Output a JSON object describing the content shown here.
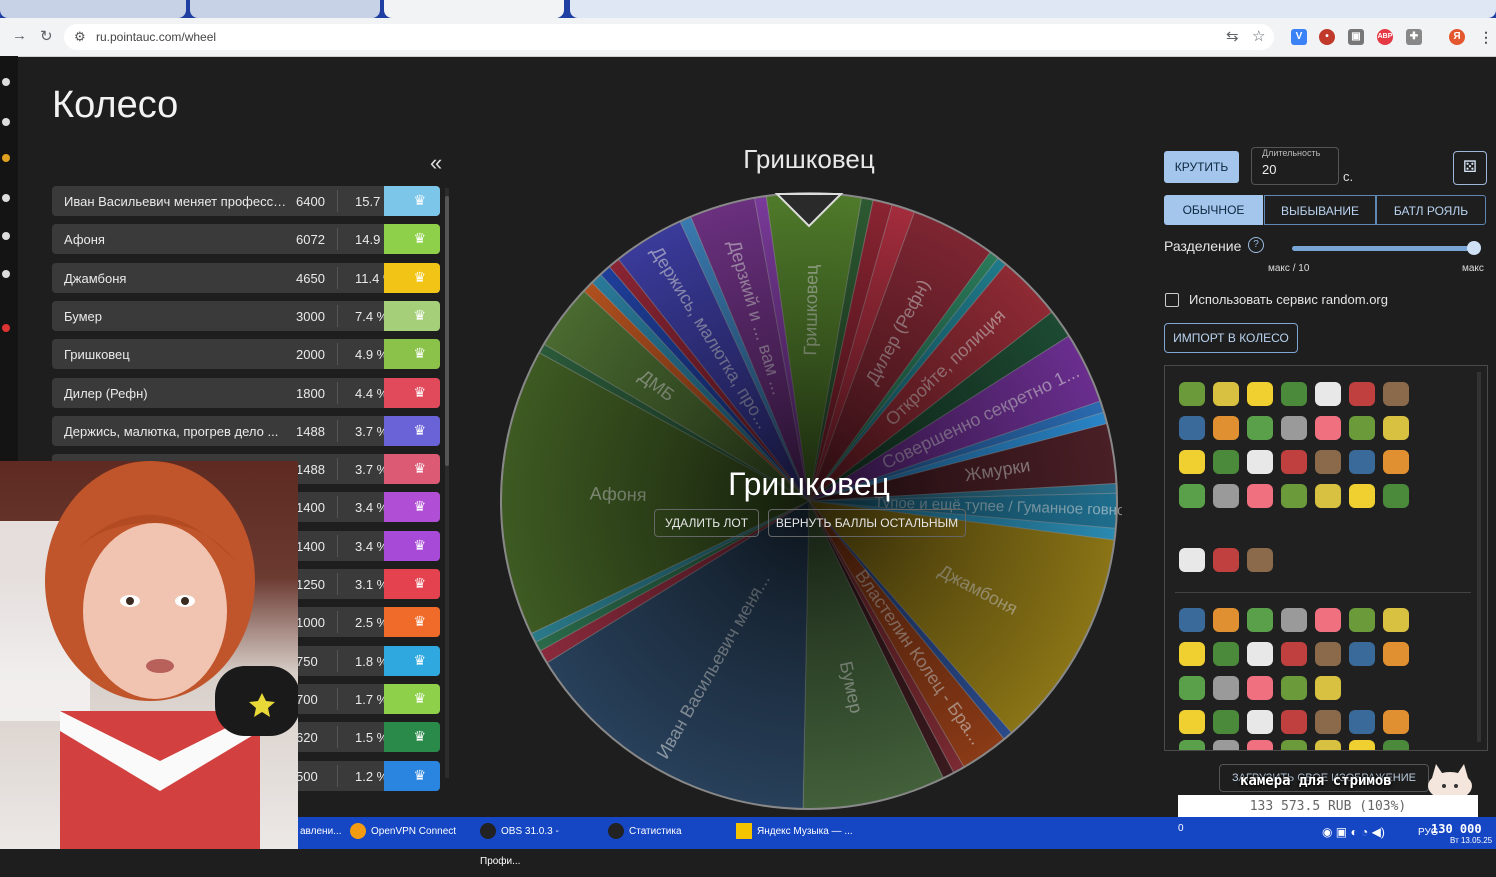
{
  "browser": {
    "url": "ru.pointauc.com/wheel"
  },
  "page": {
    "title": "Колесо",
    "collapse_icon": "«"
  },
  "lots": [
    {
      "name": "Иван Васильевич меняет профессию",
      "amount": "6400",
      "percent": "15.7 %",
      "color": "#7cc6ea"
    },
    {
      "name": "Афоня",
      "amount": "6072",
      "percent": "14.9 %",
      "color": "#8fd04b"
    },
    {
      "name": "Джамбоня",
      "amount": "4650",
      "percent": "11.4 %",
      "color": "#f2c416"
    },
    {
      "name": "Бумер",
      "amount": "3000",
      "percent": "7.4 %",
      "color": "#a6cf7a"
    },
    {
      "name": "Гришковец",
      "amount": "2000",
      "percent": "4.9 %",
      "color": "#8ac24a"
    },
    {
      "name": "Дилер (Рефн)",
      "amount": "1800",
      "percent": "4.4 %",
      "color": "#e14a5a"
    },
    {
      "name": "Держись, малютка, прогрев дело ...",
      "amount": "1488",
      "percent": "3.7 %",
      "color": "#6a63d8"
    },
    {
      "name": "",
      "amount": "1488",
      "percent": "3.7 %",
      "color": "#dd5a75"
    },
    {
      "name": "",
      "amount": "1400",
      "percent": "3.4 %",
      "color": "#b04fd6"
    },
    {
      "name": "",
      "amount": "1400",
      "percent": "3.4 %",
      "color": "#a84ad8"
    },
    {
      "name": "",
      "amount": "1250",
      "percent": "3.1 %",
      "color": "#e3424e"
    },
    {
      "name": "",
      "amount": "1000",
      "percent": "2.5 %",
      "color": "#f06a2a"
    },
    {
      "name": "",
      "amount": "750",
      "percent": "1.8 %",
      "color": "#2fa8e0"
    },
    {
      "name": "",
      "amount": "700",
      "percent": "1.7 %",
      "color": "#8fd04b"
    },
    {
      "name": "",
      "amount": "620",
      "percent": "1.5 %",
      "color": "#2a8a4a"
    },
    {
      "name": "",
      "amount": "500",
      "percent": "1.2 %",
      "color": "#2a85e0"
    }
  ],
  "wheel": {
    "winner_title": "Гришковец",
    "center_winner": "Гришковец",
    "delete_lot_label": "УДАЛИТЬ ЛОТ",
    "return_points_label": "ВЕРНУТЬ БАЛЛЫ ОСТАЛЬНЫМ",
    "segments": [
      {
        "label": "Гришковец",
        "value": 4.9,
        "color": "#4f7a2a"
      },
      {
        "label": "",
        "value": 0.6,
        "color": "#2d5a32"
      },
      {
        "label": "",
        "value": 1.0,
        "color": "#8a2432"
      },
      {
        "label": "",
        "value": 1.2,
        "color": "#a32c3c"
      },
      {
        "label": "Дилер (Рефн)",
        "value": 4.4,
        "color": "#7e2632"
      },
      {
        "label": "",
        "value": 0.5,
        "color": "#2a7a5a"
      },
      {
        "label": "",
        "value": 0.5,
        "color": "#1f7a8a"
      },
      {
        "label": "Откройте, полиция",
        "value": 3.4,
        "color": "#8e2a34"
      },
      {
        "label": "",
        "value": 1.5,
        "color": "#1d4a32"
      },
      {
        "label": "Совершенно секретно 1...",
        "value": 3.7,
        "color": "#6a2e8e"
      },
      {
        "label": "",
        "value": 0.6,
        "color": "#2a6ab0"
      },
      {
        "label": "",
        "value": 0.6,
        "color": "#2a85c8"
      },
      {
        "label": "Жмурки",
        "value": 3.1,
        "color": "#4a1f26"
      },
      {
        "label": "",
        "value": 0.5,
        "color": "#2b6e8a"
      },
      {
        "label": "Тупое и ещё тупее / Гуманное говно",
        "value": 1.8,
        "color": "#1f6e8e"
      },
      {
        "label": "",
        "value": 0.6,
        "color": "#2a8ab0"
      },
      {
        "label": "Джамбоня",
        "value": 11.4,
        "color": "#8a7416"
      },
      {
        "label": "",
        "value": 0.5,
        "color": "#2a4a8a"
      },
      {
        "label": "Властелин Колец - Бра...",
        "value": 2.5,
        "color": "#8a3a16"
      },
      {
        "label": "",
        "value": 0.6,
        "color": "#7a2a32"
      },
      {
        "label": "",
        "value": 0.6,
        "color": "#3a1a1e"
      },
      {
        "label": "Бумер",
        "value": 7.4,
        "color": "#42603a"
      },
      {
        "label": "Иван Васильевич меня...",
        "value": 15.7,
        "color": "#28405a"
      },
      {
        "label": "",
        "value": 0.7,
        "color": "#8a2a3c"
      },
      {
        "label": "",
        "value": 0.5,
        "color": "#2a6a4a"
      },
      {
        "label": "",
        "value": 0.5,
        "color": "#2a7a8a"
      },
      {
        "label": "Афоня",
        "value": 14.9,
        "color": "#3e5a22"
      },
      {
        "label": "",
        "value": 0.5,
        "color": "#2a5a3a"
      },
      {
        "label": "ДМБ",
        "value": 3.4,
        "color": "#4a6a30"
      },
      {
        "label": "",
        "value": 0.6,
        "color": "#b0501e"
      },
      {
        "label": "",
        "value": 0.6,
        "color": "#2a7a9a"
      },
      {
        "label": "",
        "value": 0.6,
        "color": "#1e3e9a"
      },
      {
        "label": "",
        "value": 0.6,
        "color": "#8a2434"
      },
      {
        "label": "Держись, малютка, про...",
        "value": 3.7,
        "color": "#3a3a9a"
      },
      {
        "label": "",
        "value": 0.6,
        "color": "#3a7ab0"
      },
      {
        "label": "Дерзкий и ... вам ...",
        "value": 3.4,
        "color": "#6a307e"
      },
      {
        "label": "",
        "value": 0.6,
        "color": "#7a3a9a"
      }
    ]
  },
  "controls": {
    "spin_label": "КРУТИТЬ",
    "duration_label": "Длительность",
    "duration_value": "20",
    "duration_unit": "с.",
    "modes": [
      "ОБЫЧНОЕ",
      "ВЫБЫВАНИЕ",
      "БАТЛ РОЯЛЬ"
    ],
    "split_label": "Разделение",
    "split_min": "макс / 10",
    "split_max": "макс",
    "random_org_label": "Использовать сервис random.org",
    "import_label": "ИМПОРТ В КОЛЕСО",
    "upload_label": "ЗАГРУЗИТЬ СВОЕ ИЗОБРАЖЕНИЕ"
  },
  "overlay": {
    "camera_title": "камера для стримов",
    "donation_text": "133 573.5 RUB (103%)"
  },
  "taskbar": {
    "items": [
      "авлени...",
      "OpenVPN Connect",
      "OBS 31.0.3 - Профи...",
      "Статистика",
      "Яндекс Музыка — ..."
    ],
    "tray_counter": "0",
    "tray_amount": "130 000",
    "tray_lang": "РУС",
    "date": "Вт 13.05.25"
  }
}
